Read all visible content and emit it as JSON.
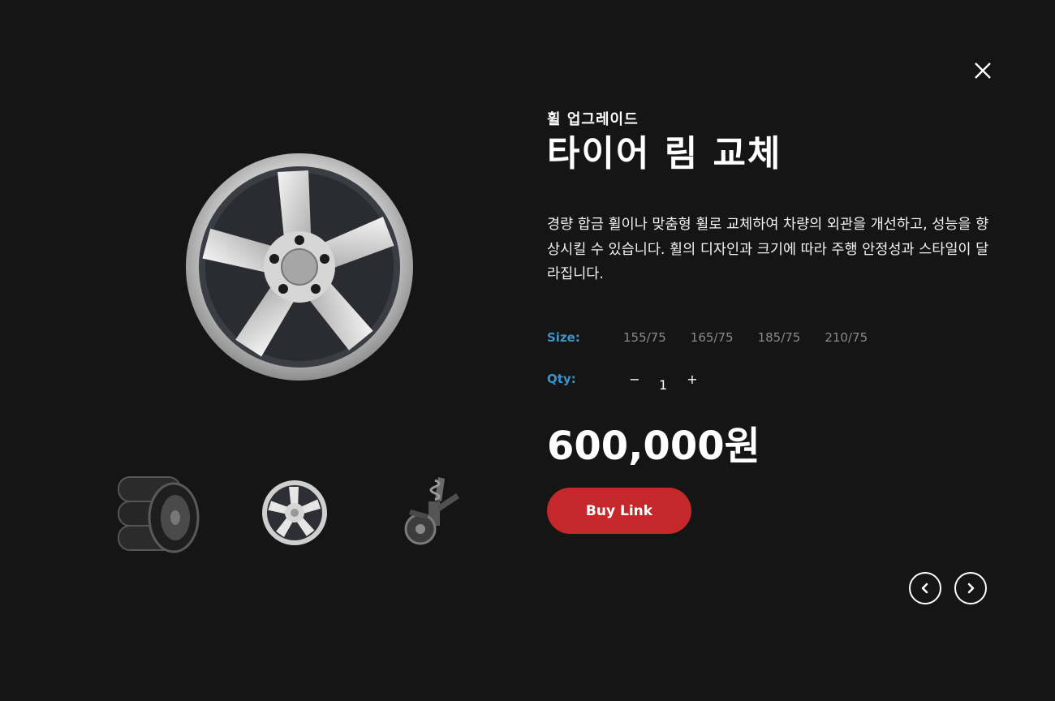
{
  "product": {
    "category": "휠 업그레이드",
    "title": "타이어 림 교체",
    "description": "경량 합금 휠이나 맞춤형 휠로 교체하여 차량의 외관을 개선하고, 성능을 향상시킬 수 있습니다. 휠의 디자인과 크기에 따라 주행 안정성과 스타일이 달라집니다.",
    "price": "600,000원"
  },
  "options": {
    "size_label": "Size:",
    "sizes": [
      "155/75",
      "165/75",
      "185/75",
      "210/75"
    ],
    "qty_label": "Qty:",
    "qty_minus": "−",
    "qty_value": "1",
    "qty_plus": "+"
  },
  "actions": {
    "buy_label": "Buy Link"
  },
  "icons": {
    "close": "close-icon",
    "prev": "chevron-left-icon",
    "next": "chevron-right-icon"
  },
  "thumbnails": [
    "tire-stack",
    "alloy-wheel",
    "suspension-strut"
  ],
  "colors": {
    "background": "#151515",
    "accent_label": "#3b94c6",
    "buy_button": "#c5282a",
    "size_option": "#8a8a8a"
  }
}
